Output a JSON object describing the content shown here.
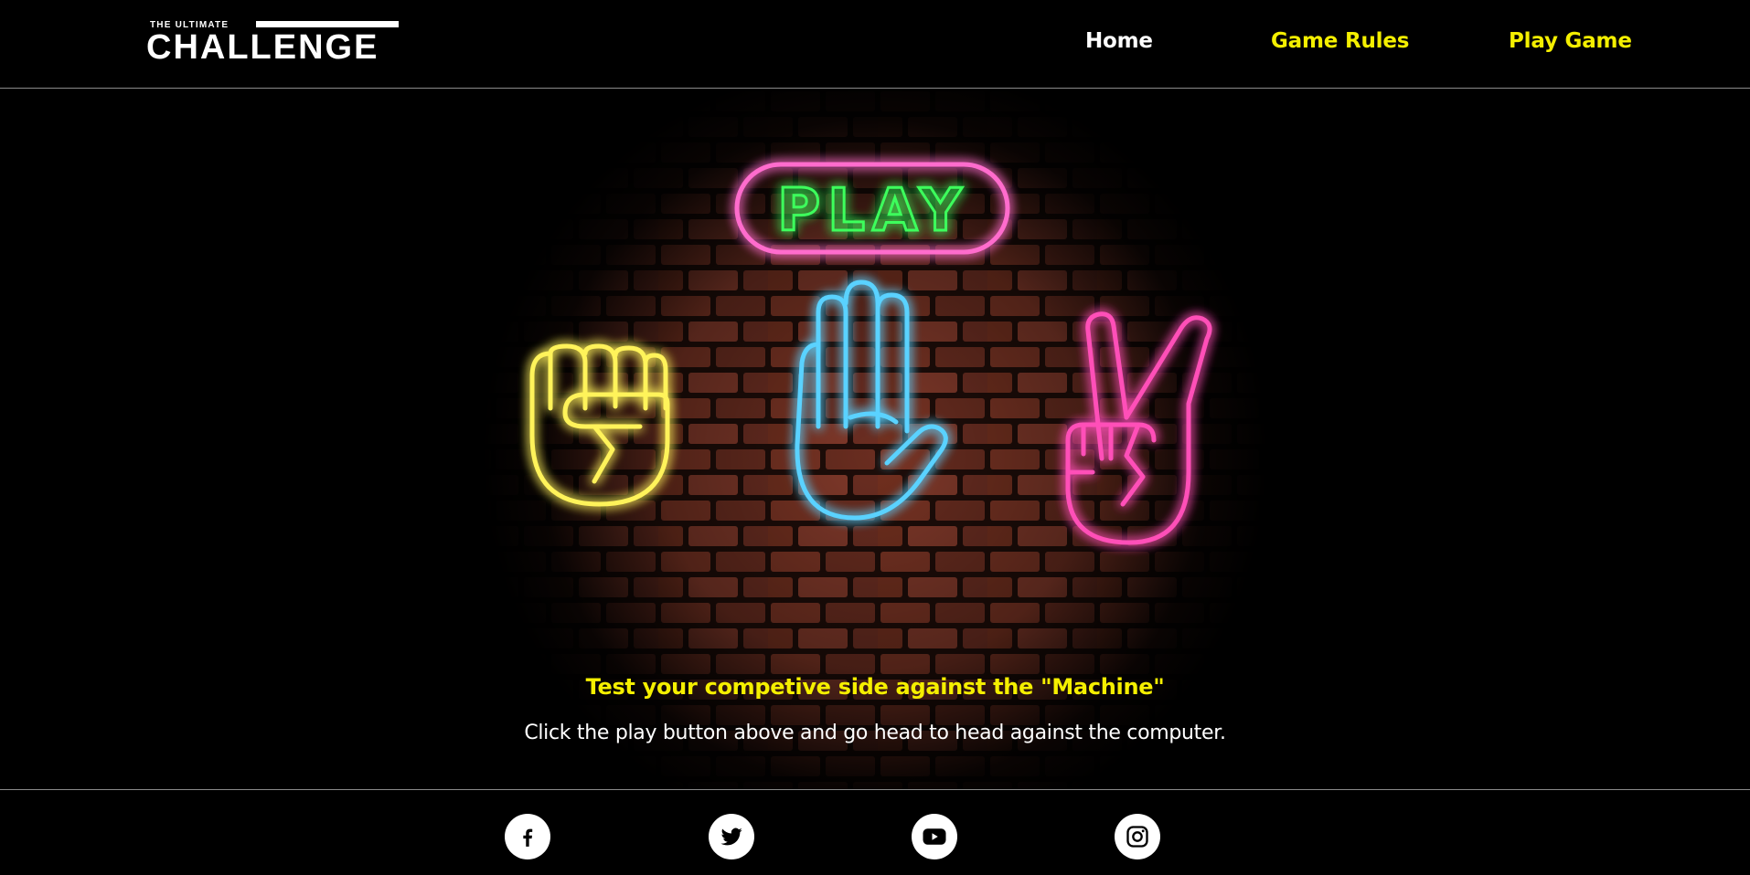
{
  "header": {
    "logo": {
      "small": "THE ULTIMATE",
      "big": "CHALLENGE"
    },
    "nav": [
      {
        "label": "Home",
        "color": "#ffffff"
      },
      {
        "label": "Game Rules",
        "color": "#f4ef00"
      },
      {
        "label": "Play Game",
        "color": "#f4ef00"
      }
    ]
  },
  "hero": {
    "play_button_label": "PLAY",
    "tagline": "Test your competive side against the \"Machine\"",
    "subtext": "Click the play button above and go head to head against the computer.",
    "icons": [
      "rock-fist-icon",
      "paper-hand-icon",
      "scissors-peace-icon"
    ],
    "colors": {
      "play_text": "#39ff5a",
      "play_border": "#ff5ec8",
      "rock": "#fff35a",
      "paper": "#5ad2ff",
      "scissors": "#ff4fb8"
    }
  },
  "footer": {
    "social": [
      "facebook-icon",
      "twitter-icon",
      "youtube-icon",
      "instagram-icon"
    ]
  }
}
